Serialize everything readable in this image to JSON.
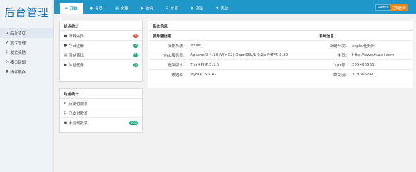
{
  "app": {
    "logo_text": "后台管理"
  },
  "colors": {
    "topbar": "#1f98c9",
    "logout_button": "#e8860f",
    "badge_red": "#d9534f",
    "badge_green": "#1fa67a"
  },
  "sidebar": {
    "items": [
      {
        "icon": "home-icon",
        "glyph": "⌂",
        "label": "后台首页"
      },
      {
        "icon": "check-icon",
        "glyph": "✔",
        "label": "支付管理"
      },
      {
        "icon": "dollar-icon",
        "glyph": "$",
        "label": "发放奖励"
      },
      {
        "icon": "link-icon",
        "glyph": "%",
        "label": "接口回调"
      },
      {
        "icon": "times-icon",
        "glyph": "✖",
        "label": "清除缓存"
      }
    ]
  },
  "topnav": {
    "tabs": [
      {
        "icon": "home-icon",
        "glyph": "⌂",
        "label": "开始"
      },
      {
        "icon": "user-icon",
        "glyph": "●",
        "label": "会员"
      },
      {
        "icon": "file-icon",
        "glyph": "▤",
        "label": "文章"
      },
      {
        "icon": "layers-icon",
        "glyph": "◆",
        "label": "体验"
      },
      {
        "icon": "plus-square-icon",
        "glyph": "⊞",
        "label": "扩展"
      },
      {
        "icon": "eye-icon",
        "glyph": "◉",
        "label": "浏览"
      },
      {
        "icon": "cogs-icon",
        "glyph": "✲",
        "label": "系统"
      }
    ],
    "admin_label": "admin",
    "logout_label": "注销登录"
  },
  "site_stats": {
    "title": "站点统计",
    "rows": [
      {
        "icon": "user-icon",
        "glyph": "●",
        "label": "所有会员",
        "count": "1",
        "color": "red"
      },
      {
        "icon": "user-icon",
        "glyph": "●",
        "label": "今日注册",
        "count": "0",
        "color": "green"
      },
      {
        "icon": "news-icon",
        "glyph": "▤",
        "label": "网站资讯",
        "count": "1",
        "color": "green"
      },
      {
        "icon": "layers-icon",
        "glyph": "◆",
        "label": "体验任务",
        "count": "0",
        "color": "green"
      }
    ]
  },
  "finance_stats": {
    "title": "财务统计",
    "rows": [
      {
        "icon": "yen-icon",
        "glyph": "¥",
        "label": "待支付款项",
        "count": ""
      },
      {
        "icon": "dollar-icon",
        "glyph": "$",
        "label": "已支付款项",
        "count": ""
      },
      {
        "icon": "money-icon",
        "glyph": "▣",
        "label": "未提现款项",
        "count": "100"
      }
    ]
  },
  "sys_info": {
    "title": "系统信息",
    "col_left": "服务器信息",
    "col_right": "系统信息",
    "rows": [
      {
        "k1": "操作系统：",
        "v1": "WINNT",
        "k2": "系统开发：",
        "v2": "aspku任务网"
      },
      {
        "k1": "Web服务器：",
        "v1": "Apache/2.4.18 (Win32) OpenSSL/1.0.2e PHP/5.3.29",
        "k2": "主页：",
        "v2": "http://www.huudi.com"
      },
      {
        "k1": "框架版本：",
        "v1": "ThinkPHP 3.1.3",
        "k2": "QQ号：",
        "v2": "395486566"
      },
      {
        "k1": "数据库：",
        "v1": "MySQL 5.5.47",
        "k2": "群交流：",
        "v2": "119368241"
      }
    ]
  }
}
